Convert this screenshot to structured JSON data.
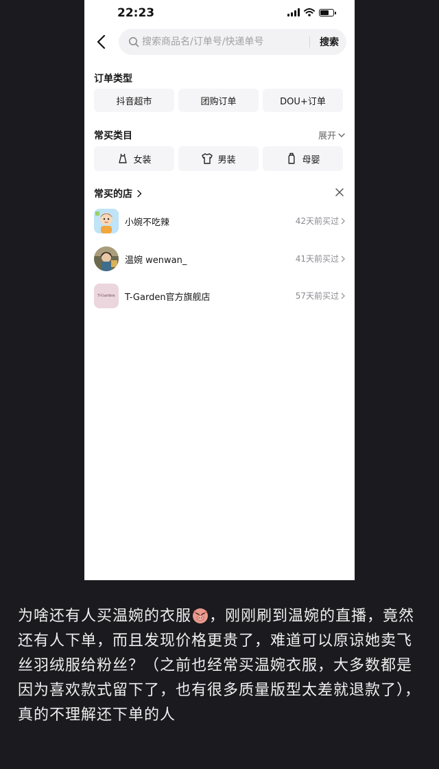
{
  "status_bar": {
    "time": "22:23",
    "battery_level": 0.75
  },
  "search": {
    "placeholder": "搜索商品名/订单号/快递单号",
    "button_label": "搜索"
  },
  "order_types": {
    "title": "订单类型",
    "items": [
      "抖音超市",
      "团购订单",
      "DOU+订单"
    ]
  },
  "categories": {
    "title": "常买类目",
    "expand_label": "展开",
    "items": [
      {
        "label": "女装",
        "icon": "dress-icon"
      },
      {
        "label": "男装",
        "icon": "tshirt-icon"
      },
      {
        "label": "母婴",
        "icon": "baby-bottle-icon"
      }
    ]
  },
  "stores": {
    "title": "常买的店",
    "items": [
      {
        "name": "小婉不吃辣",
        "last_bought": "42天前买过"
      },
      {
        "name": "温婉 wenwan_",
        "last_bought": "41天前买过"
      },
      {
        "name": "T-Garden官方旗舰店",
        "last_bought": "57天前买过",
        "logo_text": "T-Garden"
      }
    ]
  },
  "post": {
    "text_before_emoji": "为啥还有人买温婉的衣服",
    "emoji": "angry-pig-emoji",
    "text_after_emoji": "，刚刚刷到温婉的直播，竟然还有人下单，而且发现价格更贵了，难道可以原谅她卖飞丝羽绒服给粉丝？（之前也经常买温婉衣服，大多数都是因为喜欢款式留下了，也有很多质量版型太差就退款了），真的不理解还下单的人"
  }
}
